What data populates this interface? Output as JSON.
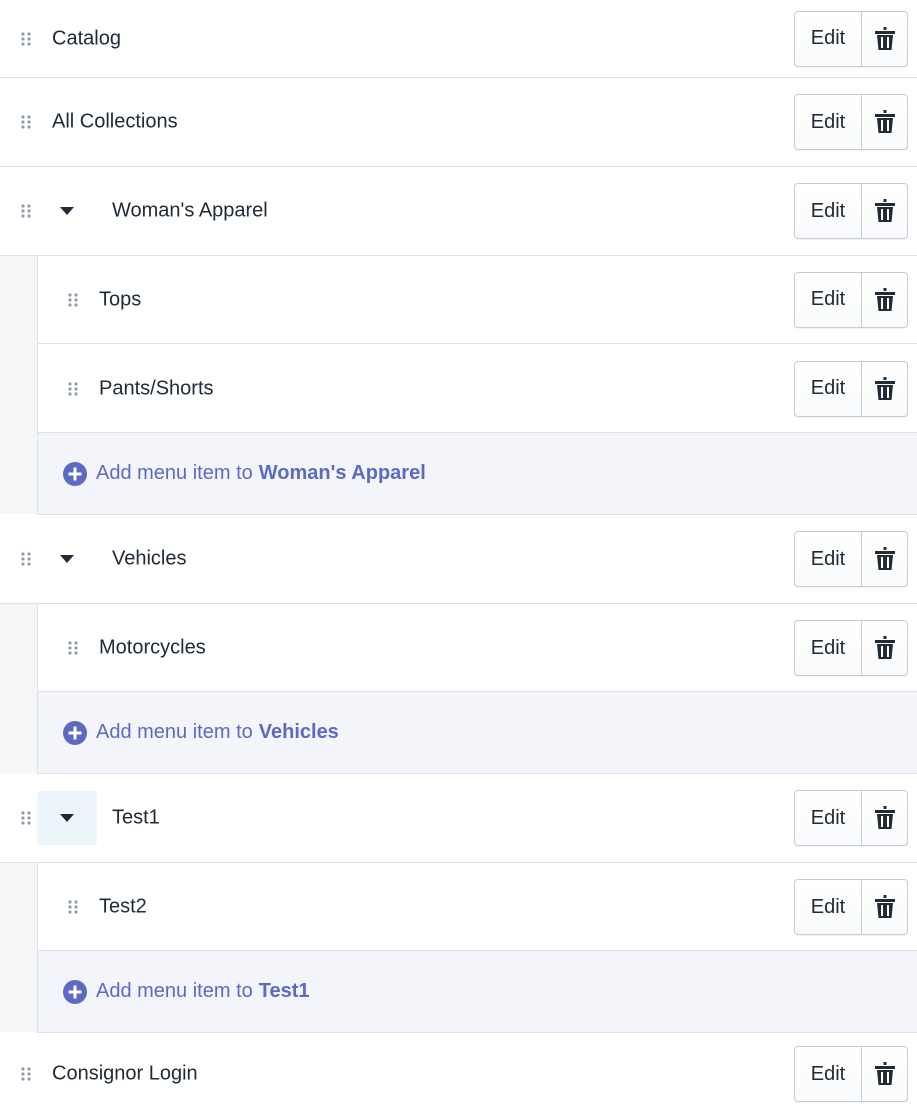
{
  "menu": {
    "edit_label": "Edit",
    "add_prefix": "Add menu item to",
    "items": [
      {
        "label": "Catalog"
      },
      {
        "label": "All Collections"
      },
      {
        "label": "Woman's Apparel"
      },
      {
        "label": "Tops"
      },
      {
        "label": "Pants/Shorts"
      },
      {
        "add_target": "Woman's Apparel"
      },
      {
        "label": "Vehicles"
      },
      {
        "label": "Motorcycles"
      },
      {
        "add_target": "Vehicles"
      },
      {
        "label": "Test1"
      },
      {
        "label": "Test2"
      },
      {
        "add_target": "Test1"
      },
      {
        "label": "Consignor Login"
      }
    ]
  },
  "colors": {
    "accent": "#5c6ac4",
    "border": "#dfe3e8",
    "nested_background": "#f4f5fa",
    "active_caret_background": "#ebf5fa"
  },
  "icons": {
    "drag": "drag-handle-icon",
    "collapse": "caret-down-icon",
    "delete": "trash-icon",
    "add": "plus-circle-icon"
  }
}
